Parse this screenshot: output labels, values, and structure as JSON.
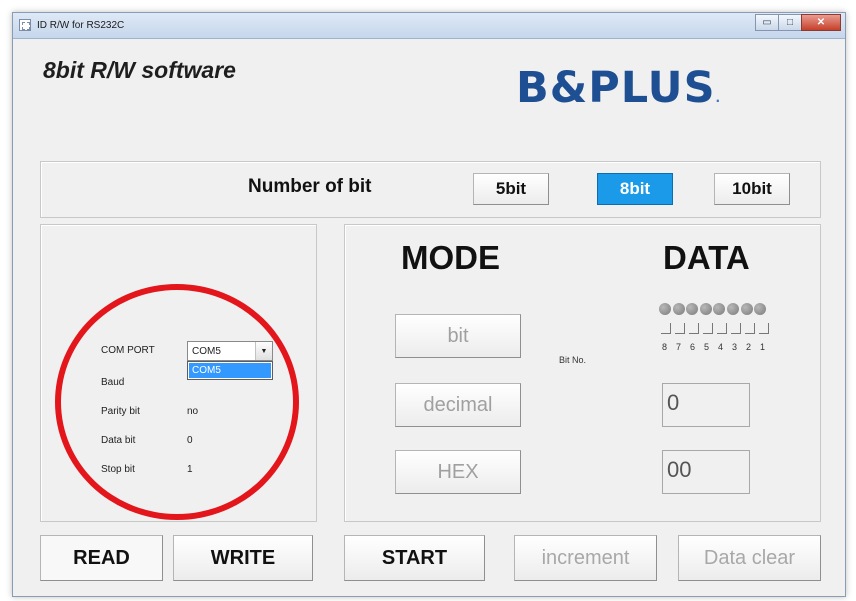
{
  "window": {
    "title": "ID R/W for RS232C",
    "controls": {
      "minimize": "▭",
      "maximize": "□",
      "close": "✕"
    }
  },
  "header": {
    "app_title": "8bit R/W software",
    "logo_text": "B&PLUS",
    "logo_dot": "."
  },
  "bits": {
    "label": "Number of bit",
    "options": [
      "5bit",
      "8bit",
      "10bit"
    ],
    "selected": "8bit"
  },
  "settings": {
    "com_port_label": "COM PORT",
    "com_port_value": "COM5",
    "dropdown_option": "COM5",
    "baud_label": "Baud",
    "parity_label": "Parity bit",
    "parity_value": "no",
    "data_bit_label": "Data bit",
    "data_bit_value": "0",
    "stop_bit_label": "Stop bit",
    "stop_bit_value": "1"
  },
  "mode": {
    "title": "MODE",
    "buttons": [
      "bit",
      "decimal",
      "HEX"
    ]
  },
  "data": {
    "title": "DATA",
    "bit_no_label": "Bit No.",
    "bit_numbers": [
      "8",
      "7",
      "6",
      "5",
      "4",
      "3",
      "2",
      "1"
    ],
    "decimal_value": "0",
    "hex_value": "00"
  },
  "actions": {
    "read": "READ",
    "write": "WRITE",
    "start": "START",
    "increment": "increment",
    "data_clear": "Data clear"
  },
  "colors": {
    "selected_button": "#1a9ae8",
    "logo": "#1e4f92",
    "annotation_circle": "#e3161b"
  }
}
